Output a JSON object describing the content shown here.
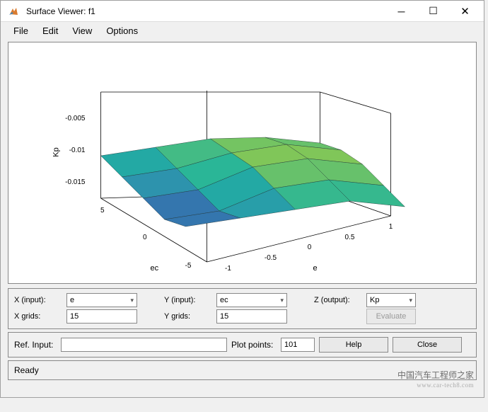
{
  "window": {
    "title": "Surface Viewer: f1"
  },
  "menu": {
    "file": "File",
    "edit": "Edit",
    "view": "View",
    "options": "Options"
  },
  "inputs_panel": {
    "x_input_label": "X (input):",
    "y_input_label": "Y (input):",
    "z_output_label": "Z (output):",
    "x_grids_label": "X grids:",
    "y_grids_label": "Y grids:",
    "x_input_value": "e",
    "y_input_value": "ec",
    "z_output_value": "Kp",
    "x_grids_value": "15",
    "y_grids_value": "15",
    "evaluate_label": "Evaluate"
  },
  "ref_panel": {
    "ref_input_label": "Ref. Input:",
    "ref_input_value": "",
    "plot_points_label": "Plot points:",
    "plot_points_value": "101",
    "help_label": "Help",
    "close_label": "Close"
  },
  "status": {
    "text": "Ready"
  },
  "watermark": {
    "line1": "中国汽车工程师之家",
    "line2": "www.car-tech8.com"
  },
  "chart_data": {
    "type": "surface",
    "title": "",
    "xlabel": "e",
    "ylabel": "ec",
    "zlabel": "Kp",
    "xlim": [
      -1,
      1
    ],
    "ylim": [
      -5,
      5
    ],
    "zlim": [
      -0.017,
      -0.003
    ],
    "xticks": [
      -1,
      -0.5,
      0,
      0.5,
      1
    ],
    "yticks": [
      -5,
      0,
      5
    ],
    "zticks": [
      -0.015,
      -0.01,
      -0.005
    ],
    "x": [
      -1,
      -0.5,
      0,
      0.5,
      1
    ],
    "y": [
      -5,
      -2.5,
      0,
      2.5,
      5
    ],
    "z": [
      [
        -0.013,
        -0.012,
        -0.011,
        -0.01,
        -0.011
      ],
      [
        -0.014,
        -0.013,
        -0.01,
        -0.009,
        -0.01
      ],
      [
        -0.013,
        -0.012,
        -0.009,
        -0.008,
        -0.009
      ],
      [
        -0.012,
        -0.011,
        -0.009,
        -0.008,
        -0.009
      ],
      [
        -0.011,
        -0.01,
        -0.009,
        -0.009,
        -0.01
      ]
    ],
    "colormap": "parula"
  }
}
